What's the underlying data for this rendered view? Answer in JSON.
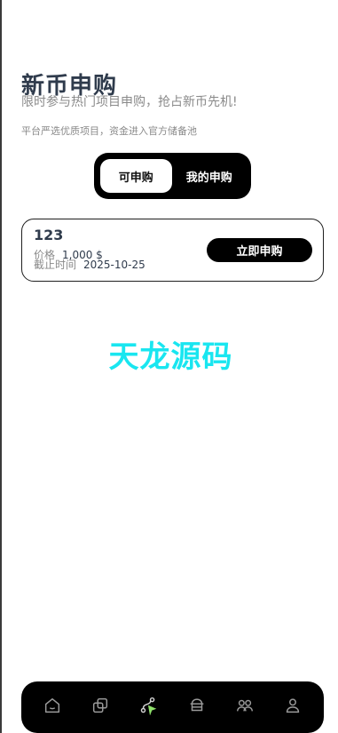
{
  "header": {
    "title": "新币申购",
    "subtitle": "限时参与热门项目申购，抢占新币先机!",
    "note": "平台严选优质项目，资金进入官方储备池"
  },
  "tabs": [
    {
      "label": "可申购",
      "active": true
    },
    {
      "label": "我的申购",
      "active": false
    }
  ],
  "card": {
    "name": "123",
    "price_key": "价格",
    "price_value": "1,000 $",
    "deadline_key": "截止时间",
    "deadline_value": "2025-10-25",
    "button_label": "立即申购"
  },
  "watermark": "天龙源码",
  "bottom_nav": [
    {
      "icon": "home-icon"
    },
    {
      "icon": "copy-icon"
    },
    {
      "icon": "route-icon",
      "active": true
    },
    {
      "icon": "vault-icon"
    },
    {
      "icon": "community-icon"
    },
    {
      "icon": "profile-icon"
    }
  ],
  "colors": {
    "title": "#2f3b4c",
    "muted": "#8a8a8a",
    "accent_nav": "#8fe06b",
    "watermark": "#19e6f0"
  }
}
